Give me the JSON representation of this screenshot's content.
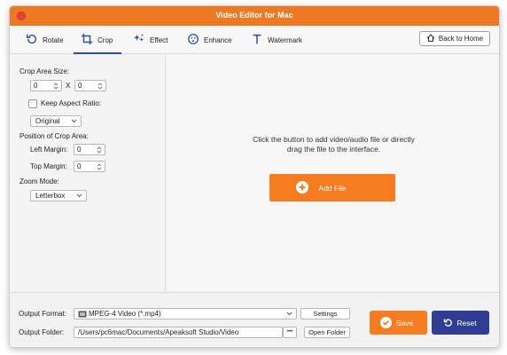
{
  "window": {
    "title": "Video Editor for Mac"
  },
  "tabs": [
    {
      "label": "Rotate",
      "icon": "rotate-icon"
    },
    {
      "label": "Crop",
      "icon": "crop-icon",
      "active": true
    },
    {
      "label": "Effect",
      "icon": "effect-icon"
    },
    {
      "label": "Enhance",
      "icon": "enhance-icon"
    },
    {
      "label": "Watermark",
      "icon": "watermark-icon"
    }
  ],
  "back_home": {
    "label": "Back to Home",
    "icon": "home-icon"
  },
  "crop_panel": {
    "crop_area_size_label": "Crop Area Size:",
    "width_value": "0",
    "x_label": "X",
    "height_value": "0",
    "keep_aspect_label": "Keep Aspect Ratio:",
    "keep_aspect_checked": false,
    "aspect_option": "Original",
    "position_label": "Position of Crop Area:",
    "left_margin_label": "Left Margin:",
    "left_margin_value": "0",
    "top_margin_label": "Top Margin:",
    "top_margin_value": "0",
    "zoom_mode_label": "Zoom Mode:",
    "zoom_mode_option": "Letterbox"
  },
  "dropzone": {
    "hint_line1": "Click the button to add video/audio file or directly",
    "hint_line2": "drag the file to the interface.",
    "add_file_label": "Add File"
  },
  "output": {
    "format_label": "Output Format:",
    "format_value": "MPEG-4 Video (*.mp4)",
    "settings_label": "Settings",
    "folder_label": "Output Folder:",
    "folder_value": "/Users/pc6mac/Documents/Apeaksoft Studio/Video",
    "browse_label": "•••",
    "open_folder_label": "Open Folder"
  },
  "actions": {
    "save_label": "Save",
    "reset_label": "Reset"
  },
  "colors": {
    "accent": "#f57d20",
    "reset": "#2e3d93",
    "title_bar": "#ed7a23",
    "active_tab": "#2d4fa0"
  }
}
